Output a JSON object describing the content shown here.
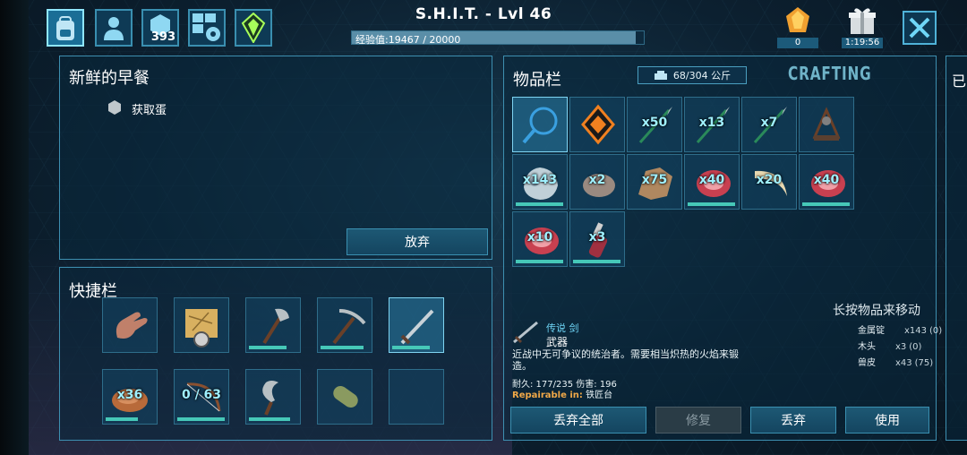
{
  "topbar": {
    "player_title": "S.H.I.T. - Lvl 46",
    "xp_text": "经验值:19467 / 20000",
    "xp_progress": 0.9734,
    "points_badge": "393",
    "ember_count": "0",
    "gift_timer": "1:19:56",
    "icons": [
      "backpack-icon",
      "character-icon",
      "engrams-icon",
      "settings-icon",
      "tek-crystal-icon"
    ]
  },
  "quest": {
    "title": "新鲜的早餐",
    "objective": "获取蛋",
    "abandon_label": "放弃"
  },
  "hotbar": {
    "title": "快捷栏",
    "slots": [
      {
        "name": "hand",
        "qty": "",
        "durability": null
      },
      {
        "name": "map-compass",
        "qty": "",
        "durability": null
      },
      {
        "name": "hatchet",
        "qty": "",
        "durability": 0.75
      },
      {
        "name": "pickaxe",
        "qty": "",
        "durability": 0.85
      },
      {
        "name": "sword",
        "qty": "",
        "durability": 0.75
      },
      {
        "name": "cooked-meat",
        "qty": "x36",
        "durability": 0.65
      },
      {
        "name": "bow",
        "qty": "0 / 63",
        "durability": 0.95
      },
      {
        "name": "sickle",
        "qty": "",
        "durability": 0.82
      },
      {
        "name": "sleeping-bag",
        "qty": "",
        "durability": null
      },
      {
        "name": "empty",
        "qty": "",
        "durability": null
      }
    ]
  },
  "inventory": {
    "title": "物品栏",
    "weight_text": "68/304 公斤",
    "crafting_tab": "CRAFTING",
    "slots": [
      {
        "name": "magnifier",
        "qty": "",
        "durability": null
      },
      {
        "name": "tek-implant",
        "qty": "",
        "durability": null
      },
      {
        "name": "spear",
        "qty": "x50",
        "durability": null
      },
      {
        "name": "spear",
        "qty": "x13",
        "durability": null
      },
      {
        "name": "spear",
        "qty": "x7",
        "durability": null
      },
      {
        "name": "campfire",
        "qty": "",
        "durability": null
      },
      {
        "name": "metal-ore",
        "qty": "x143",
        "durability": 0.95
      },
      {
        "name": "stone",
        "qty": "x2",
        "durability": null
      },
      {
        "name": "hide",
        "qty": "x75",
        "durability": null
      },
      {
        "name": "raw-meat",
        "qty": "x40",
        "durability": 0.95
      },
      {
        "name": "tusk",
        "qty": "x20",
        "durability": null
      },
      {
        "name": "raw-meat",
        "qty": "x40",
        "durability": 0.95
      },
      {
        "name": "raw-meat",
        "qty": "x10",
        "durability": 0.95
      },
      {
        "name": "bottle",
        "qty": "x3",
        "durability": 0.95
      }
    ],
    "hint": "长按物品来移动",
    "requirements": [
      {
        "name": "金属锭",
        "count": "x143",
        "have": "(0)"
      },
      {
        "name": "木头",
        "count": "x3",
        "have": "(0)"
      },
      {
        "name": "兽皮",
        "count": "x43",
        "have": "(75)"
      }
    ],
    "item_info": {
      "rarity": "传说 剑",
      "type": "武器",
      "description": "近战中无可争议的统治者。需要相当炽热的火焰来锻造。",
      "stats": "耐久: 177/235 伤害: 196",
      "repair_key": "Repairable in:",
      "repair_value": "铁匠台"
    },
    "buttons": {
      "drop_all": "丢弃全部",
      "repair": "修复",
      "drop": "丢弃",
      "use": "使用"
    }
  },
  "right_panel_char": "已",
  "colors": {
    "accent": "#3d8fb0",
    "durability": "#46c8b8",
    "qty_text": "#9ff0ff",
    "repair_key": "#f0a848"
  }
}
